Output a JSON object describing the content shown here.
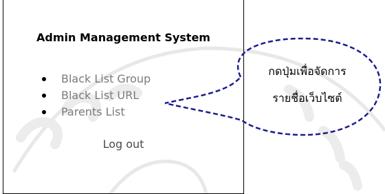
{
  "panel": {
    "title": "Admin Management System",
    "menu_items": [
      {
        "label": "Black List Group"
      },
      {
        "label": "Black List URL"
      },
      {
        "label": "Parents List"
      }
    ],
    "logout_label": "Log out"
  },
  "callout": {
    "line1": "กดปุ่มเพื่อจัดการ",
    "line2": "รายชื่อเว็บไซต์",
    "border_color": "#1c1c8a"
  },
  "watermark": {
    "color": "#e6e6e6"
  }
}
